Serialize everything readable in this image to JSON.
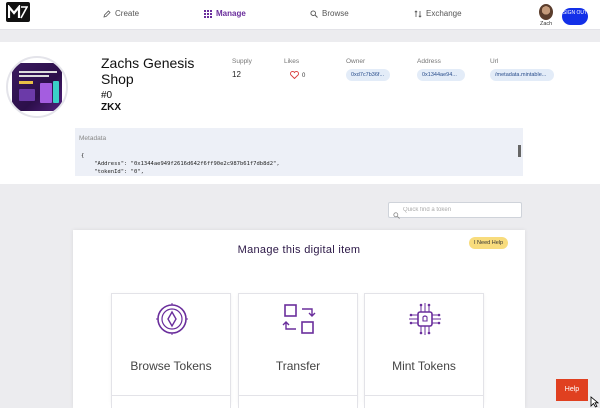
{
  "nav": {
    "create": "Create",
    "manage": "Manage",
    "browse": "Browse",
    "exchange": "Exchange",
    "user": "Zach",
    "signout": "SIGN OUT"
  },
  "item": {
    "name": "Zachs Genesis Shop",
    "token_id": "#0",
    "symbol": "ZKX",
    "supply_label": "Supply",
    "supply_value": "12",
    "likes_label": "Likes",
    "likes_value": "0",
    "owner_label": "Owner",
    "owner_value": "0xd7c7b36f...",
    "address_label": "Address",
    "address_value": "0x1344ae94...",
    "url_label": "Url",
    "url_value": "/metadata.mintable..."
  },
  "metadata": {
    "title": "Metadata",
    "lines": [
      "{",
      "    \"Address\": \"0x1344ae949f2616d642f6ff90e2c987b61f7db8d2\",",
      "    \"tokenId\": \"0\","
    ]
  },
  "search": {
    "placeholder": "Quick find a token"
  },
  "manage": {
    "title": "Manage this digital item",
    "need_help": "I Need Help",
    "cards": [
      "Browse Tokens",
      "Transfer",
      "Mint Tokens"
    ]
  },
  "help": "Help",
  "colors": {
    "accent": "#6a2e9c",
    "signout": "#1330e8",
    "help": "#e04020"
  }
}
